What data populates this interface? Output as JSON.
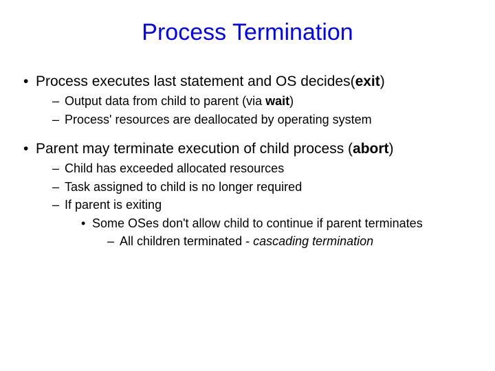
{
  "title": "Process Termination",
  "b1": {
    "pre": "Process executes last statement and OS decides(",
    "bold": "exit",
    "post": ")"
  },
  "b1s1": {
    "pre": "Output data from child to parent (via ",
    "bold": "wait",
    "post": ")"
  },
  "b1s2": "Process' resources are deallocated by operating system",
  "b2": {
    "pre": "Parent may terminate execution of child process (",
    "bold": "abort",
    "post": ")"
  },
  "b2s1": "Child has exceeded allocated resources",
  "b2s2": "Task assigned to child is no longer required",
  "b2s3": "If parent is exiting",
  "b2s3a": "Some OSes don't allow child to continue if parent terminates",
  "b2s3a1": {
    "pre": "All children terminated - ",
    "ital": "cascading termination"
  }
}
